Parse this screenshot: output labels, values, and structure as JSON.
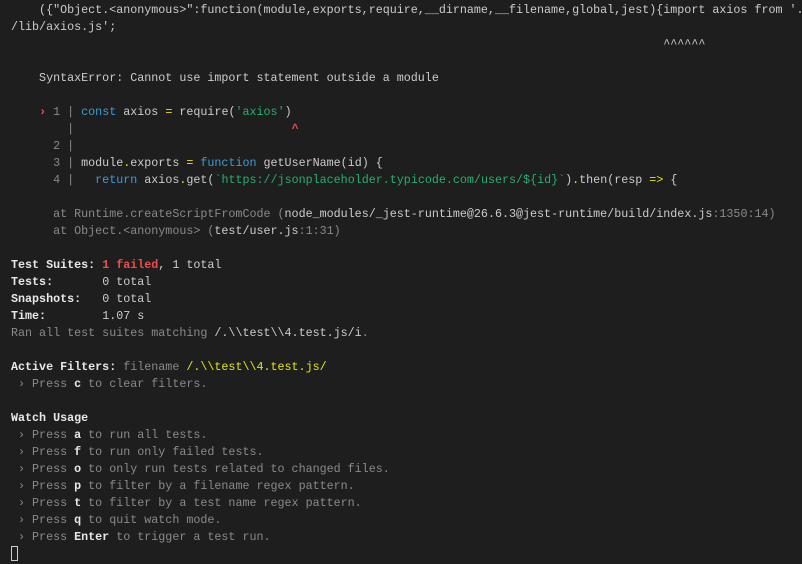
{
  "colors": {
    "n": "#cccccc",
    "d": "#8a8a8a",
    "b": "#e8e8e8",
    "r": "#f14c4c",
    "y": "#e5e510",
    "k": "#3b9cd6",
    "s": "#23b06f",
    "o": "#e5e510",
    "m": "#f14c4c",
    "background": "#1e1e1e"
  },
  "lines": [
    {
      "segs": [
        {
          "t": "    ({\"Object.<anonymous>\":function(module,exports,require,__dirname,__filename,global,jest){import axios from '.",
          "c": "n"
        }
      ]
    },
    {
      "segs": [
        {
          "t": "/lib/axios.js';",
          "c": "n"
        }
      ]
    },
    {
      "segs": [
        {
          "t": "                                                                                             ^^^^^^",
          "c": "n"
        }
      ]
    },
    {
      "segs": []
    },
    {
      "segs": [
        {
          "t": "    SyntaxError: Cannot use import statement outside a module",
          "c": "n"
        }
      ]
    },
    {
      "segs": []
    },
    {
      "segs": [
        {
          "t": "    ",
          "c": "n"
        },
        {
          "t": "›",
          "c": "m"
        },
        {
          "t": " 1 ",
          "c": "d"
        },
        {
          "t": "|",
          "c": "d"
        },
        {
          "t": " ",
          "c": "n"
        },
        {
          "t": "const",
          "c": "k"
        },
        {
          "t": " axios ",
          "c": "n"
        },
        {
          "t": "=",
          "c": "o"
        },
        {
          "t": " require(",
          "c": "n"
        },
        {
          "t": "'axios'",
          "c": "s"
        },
        {
          "t": ")",
          "c": "n"
        }
      ]
    },
    {
      "segs": [
        {
          "t": "        ",
          "c": "n"
        },
        {
          "t": "|",
          "c": "d"
        },
        {
          "t": "                               ",
          "c": "n"
        },
        {
          "t": "^",
          "c": "m"
        }
      ]
    },
    {
      "segs": [
        {
          "t": "      2 ",
          "c": "d"
        },
        {
          "t": "|",
          "c": "d"
        }
      ]
    },
    {
      "segs": [
        {
          "t": "      3 ",
          "c": "d"
        },
        {
          "t": "|",
          "c": "d"
        },
        {
          "t": " module",
          "c": "n"
        },
        {
          "t": ".",
          "c": "o"
        },
        {
          "t": "exports ",
          "c": "n"
        },
        {
          "t": "=",
          "c": "o"
        },
        {
          "t": " ",
          "c": "n"
        },
        {
          "t": "function",
          "c": "k"
        },
        {
          "t": " getUserName(id) {",
          "c": "n"
        }
      ]
    },
    {
      "segs": [
        {
          "t": "      4 ",
          "c": "d"
        },
        {
          "t": "|",
          "c": "d"
        },
        {
          "t": "   ",
          "c": "n"
        },
        {
          "t": "return",
          "c": "k"
        },
        {
          "t": " axios",
          "c": "n"
        },
        {
          "t": ".",
          "c": "o"
        },
        {
          "t": "get(",
          "c": "n"
        },
        {
          "t": "`https://jsonplaceholder.typicode.com/users/${id}`",
          "c": "s"
        },
        {
          "t": ")",
          "c": "n"
        },
        {
          "t": ".",
          "c": "o"
        },
        {
          "t": "then(resp ",
          "c": "n"
        },
        {
          "t": "=>",
          "c": "o"
        },
        {
          "t": " {",
          "c": "n"
        }
      ]
    },
    {
      "segs": []
    },
    {
      "segs": [
        {
          "t": "      at Runtime.createScriptFromCode (",
          "c": "d"
        },
        {
          "t": "node_modules/_jest-runtime@26.6.3@jest-runtime/build/index.js",
          "c": "n"
        },
        {
          "t": ":1350:14)",
          "c": "d"
        }
      ]
    },
    {
      "segs": [
        {
          "t": "      at Object.<anonymous> (",
          "c": "d"
        },
        {
          "t": "test/user.js",
          "c": "n"
        },
        {
          "t": ":1:31)",
          "c": "d"
        }
      ]
    },
    {
      "segs": []
    },
    {
      "segs": [
        {
          "t": "Test Suites: ",
          "c": "b"
        },
        {
          "t": "1 failed",
          "c": "r"
        },
        {
          "t": ", 1 total",
          "c": "n"
        }
      ]
    },
    {
      "segs": [
        {
          "t": "Tests:       ",
          "c": "b"
        },
        {
          "t": "0 total",
          "c": "n"
        }
      ]
    },
    {
      "segs": [
        {
          "t": "Snapshots:   ",
          "c": "b"
        },
        {
          "t": "0 total",
          "c": "n"
        }
      ]
    },
    {
      "segs": [
        {
          "t": "Time:        ",
          "c": "b"
        },
        {
          "t": "1.07 s",
          "c": "n"
        }
      ]
    },
    {
      "segs": [
        {
          "t": "Ran all test suites matching ",
          "c": "d"
        },
        {
          "t": "/.\\\\test\\\\4.test.js/i",
          "c": "n"
        },
        {
          "t": ".",
          "c": "d"
        }
      ]
    },
    {
      "segs": []
    },
    {
      "segs": [
        {
          "t": "Active Filters: ",
          "c": "b"
        },
        {
          "t": "filename ",
          "c": "d"
        },
        {
          "t": "/.\\\\test\\\\4.test.js/",
          "c": "y"
        }
      ]
    },
    {
      "segs": [
        {
          "t": " › Press ",
          "c": "d"
        },
        {
          "t": "c",
          "c": "b"
        },
        {
          "t": " to clear filters.",
          "c": "d"
        }
      ]
    },
    {
      "segs": []
    },
    {
      "segs": [
        {
          "t": "Watch Usage",
          "c": "b"
        }
      ]
    },
    {
      "segs": [
        {
          "t": " › Press ",
          "c": "d"
        },
        {
          "t": "a",
          "c": "b"
        },
        {
          "t": " to run all tests.",
          "c": "d"
        }
      ]
    },
    {
      "segs": [
        {
          "t": " › Press ",
          "c": "d"
        },
        {
          "t": "f",
          "c": "b"
        },
        {
          "t": " to run only failed tests.",
          "c": "d"
        }
      ]
    },
    {
      "segs": [
        {
          "t": " › Press ",
          "c": "d"
        },
        {
          "t": "o",
          "c": "b"
        },
        {
          "t": " to only run tests related to changed files.",
          "c": "d"
        }
      ]
    },
    {
      "segs": [
        {
          "t": " › Press ",
          "c": "d"
        },
        {
          "t": "p",
          "c": "b"
        },
        {
          "t": " to filter by a filename regex pattern.",
          "c": "d"
        }
      ]
    },
    {
      "segs": [
        {
          "t": " › Press ",
          "c": "d"
        },
        {
          "t": "t",
          "c": "b"
        },
        {
          "t": " to filter by a test name regex pattern.",
          "c": "d"
        }
      ]
    },
    {
      "segs": [
        {
          "t": " › Press ",
          "c": "d"
        },
        {
          "t": "q",
          "c": "b"
        },
        {
          "t": " to quit watch mode.",
          "c": "d"
        }
      ]
    },
    {
      "segs": [
        {
          "t": " › Press ",
          "c": "d"
        },
        {
          "t": "Enter",
          "c": "b"
        },
        {
          "t": " to trigger a test run.",
          "c": "d"
        }
      ]
    }
  ]
}
